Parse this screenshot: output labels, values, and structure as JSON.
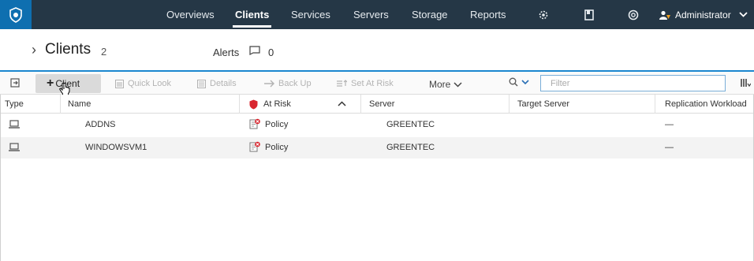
{
  "colors": {
    "nav_bg": "#253746",
    "logo_bg": "#0e6fb0",
    "accent": "#1a87d0",
    "risk_red": "#d9262f"
  },
  "nav": {
    "logo_icon": "shield-logo-icon",
    "items": [
      "Overviews",
      "Clients",
      "Services",
      "Servers",
      "Storage",
      "Reports"
    ],
    "active": "Clients",
    "icons": [
      "settings-icon",
      "bookmark-icon",
      "help-icon"
    ],
    "user": "Administrator"
  },
  "header": {
    "title": "Clients",
    "count": "2",
    "alerts_label": "Alerts",
    "alerts_count": "0"
  },
  "toolbar": {
    "add_client": "Client",
    "quick_look": "Quick Look",
    "details": "Details",
    "back_up": "Back Up",
    "set_at_risk": "Set At Risk",
    "more": "More",
    "filter_placeholder": "Filter"
  },
  "table": {
    "columns": [
      "Type",
      "Name",
      "At Risk",
      "Server",
      "Target Server",
      "Replication Workload"
    ],
    "sort_column": "At Risk",
    "rows": [
      {
        "type": "laptop-icon",
        "name": "ADDNS",
        "at_risk": "Policy",
        "server": "GREENTEC",
        "target_server": "",
        "replication": "—"
      },
      {
        "type": "laptop-icon",
        "name": "WINDOWSVM1",
        "at_risk": "Policy",
        "server": "GREENTEC",
        "target_server": "",
        "replication": "—"
      }
    ]
  }
}
